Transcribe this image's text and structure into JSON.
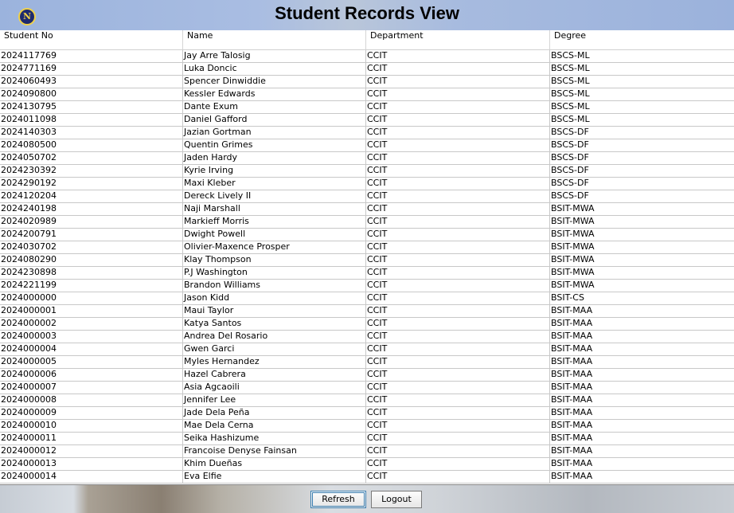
{
  "window": {
    "title": "Student Records View",
    "logo_text": "N"
  },
  "table": {
    "columns": [
      "Student No",
      "Name",
      "Department",
      "Degree"
    ],
    "rows": [
      [
        "2024117769",
        "Jay Arre Talosig",
        "CCIT",
        "BSCS-ML"
      ],
      [
        "2024771169",
        "Luka Doncic",
        "CCIT",
        "BSCS-ML"
      ],
      [
        "2024060493",
        "Spencer Dinwiddie",
        "CCIT",
        "BSCS-ML"
      ],
      [
        "2024090800",
        "Kessler Edwards",
        "CCIT",
        "BSCS-ML"
      ],
      [
        "2024130795",
        "Dante Exum",
        "CCIT",
        "BSCS-ML"
      ],
      [
        "2024011098",
        "Daniel Gafford",
        "CCIT",
        "BSCS-ML"
      ],
      [
        "2024140303",
        "Jazian Gortman",
        "CCIT",
        "BSCS-DF"
      ],
      [
        "2024080500",
        "Quentin Grimes",
        "CCIT",
        "BSCS-DF"
      ],
      [
        "2024050702",
        "Jaden Hardy",
        "CCIT",
        "BSCS-DF"
      ],
      [
        "2024230392",
        "Kyrie Irving",
        "CCIT",
        "BSCS-DF"
      ],
      [
        "2024290192",
        "Maxi Kleber",
        "CCIT",
        "BSCS-DF"
      ],
      [
        "2024120204",
        "Dereck Lively II",
        "CCIT",
        "BSCS-DF"
      ],
      [
        "2024240198",
        "Naji Marshall",
        "CCIT",
        "BSIT-MWA"
      ],
      [
        "2024020989",
        "Markieff Morris",
        "CCIT",
        "BSIT-MWA"
      ],
      [
        "2024200791",
        "Dwight Powell",
        "CCIT",
        "BSIT-MWA"
      ],
      [
        "2024030702",
        "Olivier-Maxence Prosper",
        "CCIT",
        "BSIT-MWA"
      ],
      [
        "2024080290",
        "Klay Thompson",
        "CCIT",
        "BSIT-MWA"
      ],
      [
        "2024230898",
        "P.J Washington",
        "CCIT",
        "BSIT-MWA"
      ],
      [
        "2024221199",
        "Brandon Williams",
        "CCIT",
        "BSIT-MWA"
      ],
      [
        "2024000000",
        "Jason Kidd",
        "CCIT",
        "BSIT-CS"
      ],
      [
        "2024000001",
        "Maui Taylor",
        "CCIT",
        "BSIT-MAA"
      ],
      [
        "2024000002",
        "Katya Santos",
        "CCIT",
        "BSIT-MAA"
      ],
      [
        "2024000003",
        "Andrea Del Rosario",
        "CCIT",
        "BSIT-MAA"
      ],
      [
        "2024000004",
        "Gwen Garci",
        "CCIT",
        "BSIT-MAA"
      ],
      [
        "2024000005",
        "Myles Hernandez",
        "CCIT",
        "BSIT-MAA"
      ],
      [
        "2024000006",
        "Hazel Cabrera",
        "CCIT",
        "BSIT-MAA"
      ],
      [
        "2024000007",
        "Asia Agcaoili",
        "CCIT",
        "BSIT-MAA"
      ],
      [
        "2024000008",
        "Jennifer Lee",
        "CCIT",
        "BSIT-MAA"
      ],
      [
        "2024000009",
        "Jade Dela Peña",
        "CCIT",
        "BSIT-MAA"
      ],
      [
        "2024000010",
        "Mae Dela Cerna",
        "CCIT",
        "BSIT-MAA"
      ],
      [
        "2024000011",
        "Seika Hashizume",
        "CCIT",
        "BSIT-MAA"
      ],
      [
        "2024000012",
        "Francoise Denyse Fainsan",
        "CCIT",
        "BSIT-MAA"
      ],
      [
        "2024000013",
        "Khim Dueñas",
        "CCIT",
        "BSIT-MAA"
      ],
      [
        "2024000014",
        "Eva Elfie",
        "CCIT",
        "BSIT-MAA"
      ]
    ]
  },
  "buttons": {
    "refresh": "Refresh",
    "logout": "Logout"
  }
}
